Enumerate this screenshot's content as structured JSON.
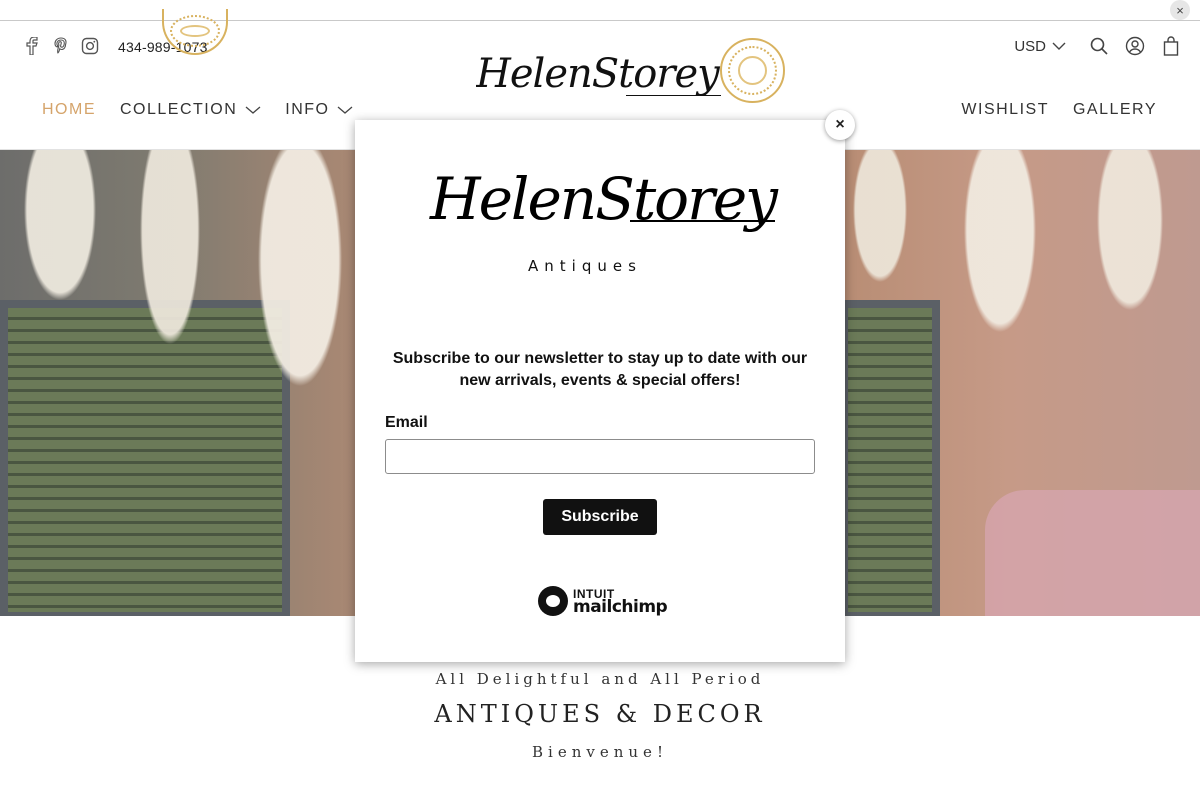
{
  "top_strip": {
    "close_glyph": "×"
  },
  "header": {
    "social_icons": [
      "facebook-icon",
      "pinterest-icon",
      "instagram-icon"
    ],
    "phone": "434-989-1073",
    "logo_text": "HelenStorey",
    "currency": "USD",
    "util_icons": [
      "search-icon",
      "account-icon",
      "cart-icon"
    ]
  },
  "nav": {
    "left": [
      {
        "label": "HOME",
        "active": true,
        "dropdown": false
      },
      {
        "label": "COLLECTION",
        "active": false,
        "dropdown": true
      },
      {
        "label": "INFO",
        "active": false,
        "dropdown": true
      }
    ],
    "right": [
      {
        "label": "WISHLIST"
      },
      {
        "label": "GALLERY"
      }
    ]
  },
  "modal": {
    "close_glyph": "×",
    "logo_script": "HelenStorey",
    "logo_sub": "Antiques",
    "copy": "Subscribe to our newsletter to stay up to date with our new arrivals, events & special offers!",
    "email_label": "Email",
    "email_value": "",
    "subscribe_label": "Subscribe",
    "badge_intuit": "INTUIT",
    "badge_mailchimp": "mailchimp"
  },
  "tagline": {
    "line1": "All Delightful and All Period",
    "line2": "ANTIQUES & DECOR",
    "line3": "Bienvenue!"
  },
  "colors": {
    "accent": "#d5a46b",
    "medallion": "#d8b25f",
    "button": "#111111"
  }
}
